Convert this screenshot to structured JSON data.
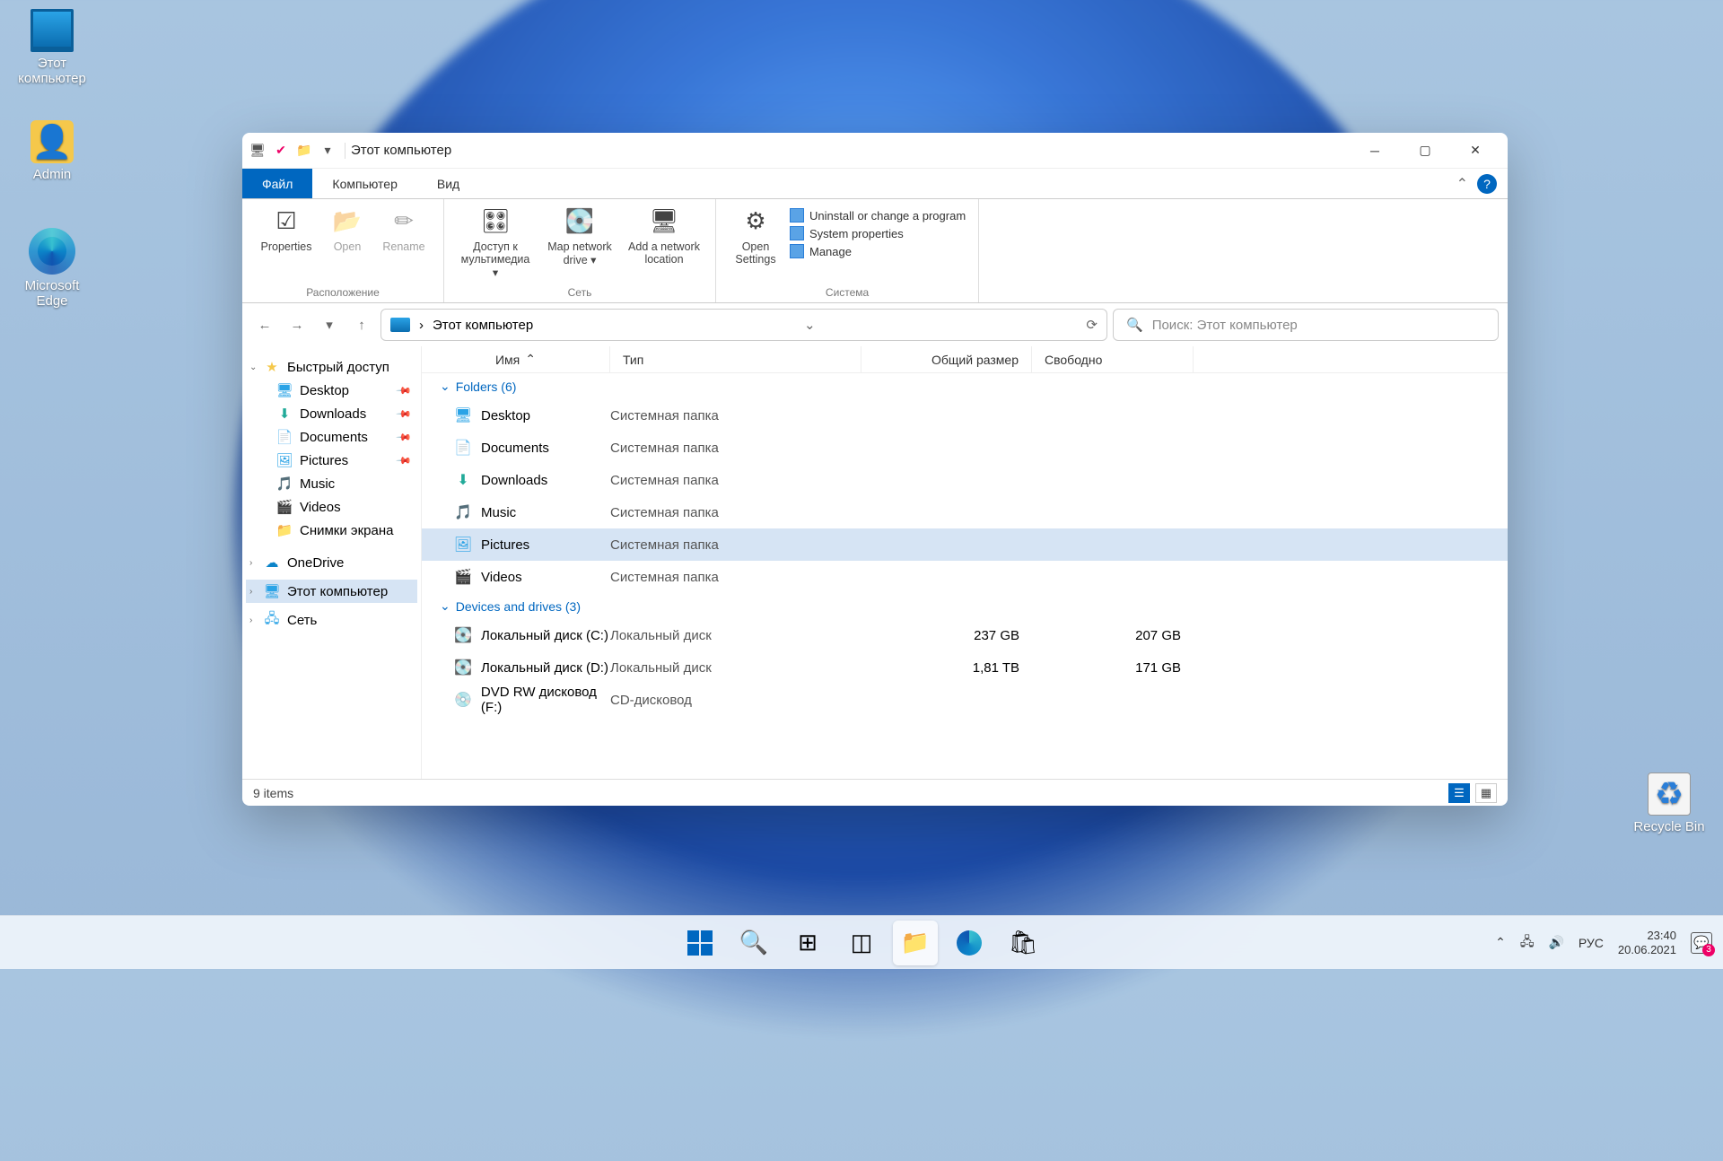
{
  "desktop": {
    "icons": [
      {
        "label": "Этот компьютер",
        "icon": "pc"
      },
      {
        "label": "Admin",
        "icon": "user"
      },
      {
        "label": "Microsoft Edge",
        "icon": "edge"
      }
    ],
    "recycle": "Recycle Bin"
  },
  "window": {
    "title": "Этот компьютер",
    "tabs": {
      "file": "Файл",
      "computer": "Компьютер",
      "view": "Вид"
    },
    "ribbon": {
      "groups": {
        "loc": {
          "label": "Расположение",
          "buttons": [
            {
              "label": "Properties",
              "enabled": true
            },
            {
              "label": "Open",
              "enabled": false
            },
            {
              "label": "Rename",
              "enabled": false
            }
          ]
        },
        "net": {
          "label": "Сеть",
          "buttons": [
            {
              "label": "Доступ к мультимедиа ▾"
            },
            {
              "label": "Map network drive ▾"
            },
            {
              "label": "Add a network location"
            }
          ]
        },
        "sys": {
          "label": "Система",
          "buttons": [
            {
              "label": "Open Settings"
            }
          ],
          "links": [
            {
              "label": "Uninstall or change a program"
            },
            {
              "label": "System properties"
            },
            {
              "label": "Manage"
            }
          ]
        }
      }
    },
    "address": {
      "path": "Этот компьютер"
    },
    "search": {
      "placeholder": "Поиск: Этот компьютер"
    },
    "nav": {
      "quick": "Быстрый доступ",
      "items": [
        {
          "label": "Desktop",
          "pin": true,
          "ic": "blue"
        },
        {
          "label": "Downloads",
          "pin": true,
          "ic": "dl"
        },
        {
          "label": "Documents",
          "pin": true,
          "ic": "doc"
        },
        {
          "label": "Pictures",
          "pin": true,
          "ic": "pic"
        },
        {
          "label": "Music",
          "pin": false,
          "ic": "mus"
        },
        {
          "label": "Videos",
          "pin": false,
          "ic": "vid"
        },
        {
          "label": "Снимки экрана",
          "pin": false,
          "ic": "fold"
        }
      ],
      "onedrive": "OneDrive",
      "thispc": "Этот компьютер",
      "network": "Сеть"
    },
    "columns": {
      "name": "Имя",
      "type": "Тип",
      "size": "Общий размер",
      "free": "Свободно"
    },
    "groups": {
      "folders": "Folders (6)",
      "drives": "Devices and drives (3)"
    },
    "folders": [
      {
        "name": "Desktop",
        "type": "Системная папка"
      },
      {
        "name": "Documents",
        "type": "Системная папка"
      },
      {
        "name": "Downloads",
        "type": "Системная папка"
      },
      {
        "name": "Music",
        "type": "Системная папка"
      },
      {
        "name": "Pictures",
        "type": "Системная папка",
        "sel": true
      },
      {
        "name": "Videos",
        "type": "Системная папка"
      }
    ],
    "drives": [
      {
        "name": "Локальный диск (C:)",
        "type": "Локальный диск",
        "size": "237 GB",
        "free": "207 GB"
      },
      {
        "name": "Локальный диск (D:)",
        "type": "Локальный диск",
        "size": "1,81 TB",
        "free": "171 GB"
      },
      {
        "name": "DVD RW дисковод (F:)",
        "type": "CD-дисковод",
        "size": "",
        "free": ""
      }
    ],
    "status": "9 items"
  },
  "taskbar": {
    "tray": {
      "lang": "РУС",
      "time": "23:40",
      "date": "20.06.2021",
      "notif": "3"
    }
  }
}
